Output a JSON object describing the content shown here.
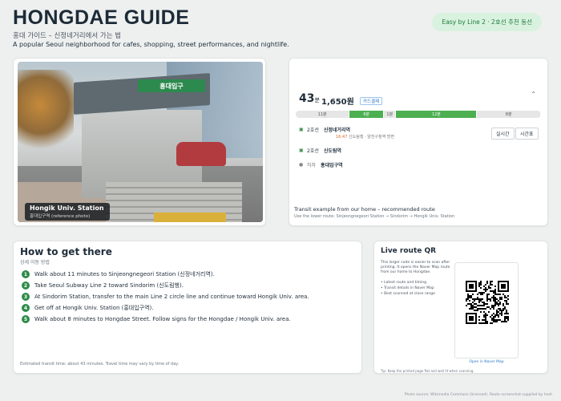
{
  "header": {
    "title": "HONGDAE GUIDE",
    "subtitle_ko": "홍대 가이드 – 신정네거리에서 가는 법",
    "subtitle_en": "A popular Seoul neighborhood for cafes, shopping, street performances, and nightlife.",
    "badge": "Easy by Line 2 · 2호선 추천 동선"
  },
  "photo": {
    "sign": "홍대입구",
    "label": "Hongik Univ. Station",
    "label_sub": "홍대입구역 (reference photo)"
  },
  "route": {
    "minutes": "43",
    "minutes_unit": "분",
    "fare": "1,650원",
    "fare_badge": "카드결제",
    "segments": [
      {
        "label": "11분",
        "kind": "walk",
        "share": 0.22
      },
      {
        "label": "6분",
        "kind": "line2",
        "share": 0.14
      },
      {
        "label": "1분",
        "kind": "walk",
        "share": 0.05
      },
      {
        "label": "12분",
        "kind": "line2",
        "share": 0.33
      },
      {
        "label": "8분",
        "kind": "walk",
        "share": 0.26
      }
    ],
    "steps": [
      {
        "icon": "subway-icon",
        "line": "2호선",
        "station": "신정네거리역",
        "detail_time": "16:47",
        "detail": "신도림행 · 양천구청역 방면"
      },
      {
        "icon": "subway-icon",
        "line": "2호선",
        "station": "신도림역",
        "detail_time": "",
        "detail": ""
      },
      {
        "icon": "walk-icon",
        "line": "하차",
        "station": "홍대입구역",
        "detail_time": "",
        "detail": ""
      }
    ],
    "buttons": [
      "실시간",
      "시간표"
    ],
    "caption": "Transit example from our home – recommended route",
    "caption_sub": "Use the lower route: Sinjeongnegeori Station → Sindorim → Hongik Univ. Station"
  },
  "how": {
    "title": "How to get there",
    "subtitle": "상세 이동 방법",
    "steps": [
      {
        "n": "1",
        "text": "Walk about 11 minutes to Sinjeongnegeori Station (신정네거리역)."
      },
      {
        "n": "2",
        "text": "Take Seoul Subway Line 2 toward Sindorim (신도림행)."
      },
      {
        "n": "3",
        "text": "At Sindorim Station, transfer to the main Line 2 circle line and continue toward Hongik Univ. area."
      },
      {
        "n": "4",
        "text": "Get off at Hongik Univ. Station (홍대입구역)."
      },
      {
        "n": "5",
        "text": "Walk about 8 minutes to Hongdae Street. Follow signs for the Hongdae / Hongik Univ. area."
      }
    ],
    "footer": "Estimated transit time: about 43 minutes. Travel time may vary by time of day."
  },
  "qr": {
    "title": "Live route QR",
    "description": "This larger code is easier to scan after printing. It opens the Naver Map route from our home to Hongdae.",
    "bullets": [
      "Latest route and timing",
      "Transit details in Naver Map",
      "Best scanned at close range"
    ],
    "open_label": "Open in Naver Map",
    "tip": "Tip: Keep the printed page flat and well lit when scanning."
  },
  "credit": "Photo source: Wikimedia Commons (licensed). Route screenshot supplied by host.",
  "colors": {
    "accent": "#2e8b47",
    "line2": "#4caf50",
    "background": "#eef0ef"
  }
}
